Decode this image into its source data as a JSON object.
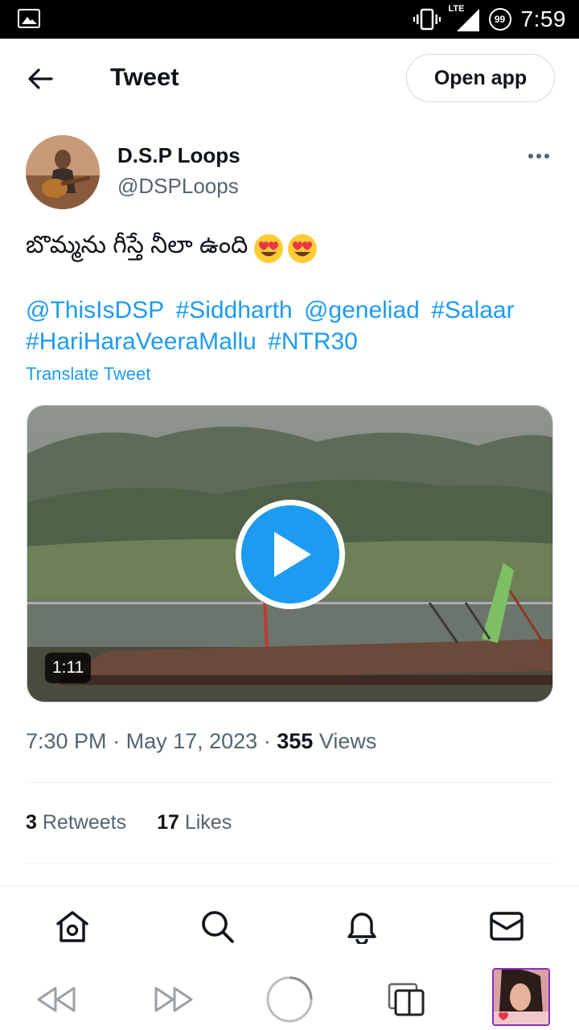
{
  "status_bar": {
    "time": "7:59",
    "network": "LTE",
    "badge_count": "99",
    "icons": [
      "image-icon",
      "vibrate-icon",
      "signal-icon",
      "notification-count-icon"
    ]
  },
  "header": {
    "back_icon": "arrow-left-icon",
    "title": "Tweet",
    "open_app_label": "Open app"
  },
  "tweet": {
    "author_name": "D.S.P Loops",
    "author_handle": "@DSPLoops",
    "text": "బొమ్మను గీస్తే నీలా ఉంది",
    "emojis": [
      "heart-eyes-emoji",
      "heart-eyes-emoji"
    ],
    "tags": [
      "@ThisIsDSP",
      "#Siddharth",
      "@geneliad",
      "#Salaar",
      "#HariHaraVeeraMallu",
      "#NTR30"
    ],
    "translate_label": "Translate Tweet",
    "video_duration": "1:11",
    "time": "7:30 PM",
    "separator": "·",
    "date": "May 17, 2023",
    "views_count": "355",
    "views_label": "Views",
    "retweets_count": "3",
    "retweets_label": "Retweets",
    "likes_count": "17",
    "likes_label": "Likes"
  },
  "bottom_nav": {
    "items": [
      "home-icon",
      "search-icon",
      "notifications-icon",
      "messages-icon"
    ]
  },
  "browser_bar": {
    "items": [
      "rewind-icon",
      "fast-forward-icon",
      "loading-spinner-icon",
      "tabs-icon",
      "tab-thumbnail"
    ]
  },
  "colors": {
    "accent": "#1d9bf0",
    "text_primary": "#0f1419",
    "text_secondary": "#536471",
    "divider": "#eff3f4"
  }
}
